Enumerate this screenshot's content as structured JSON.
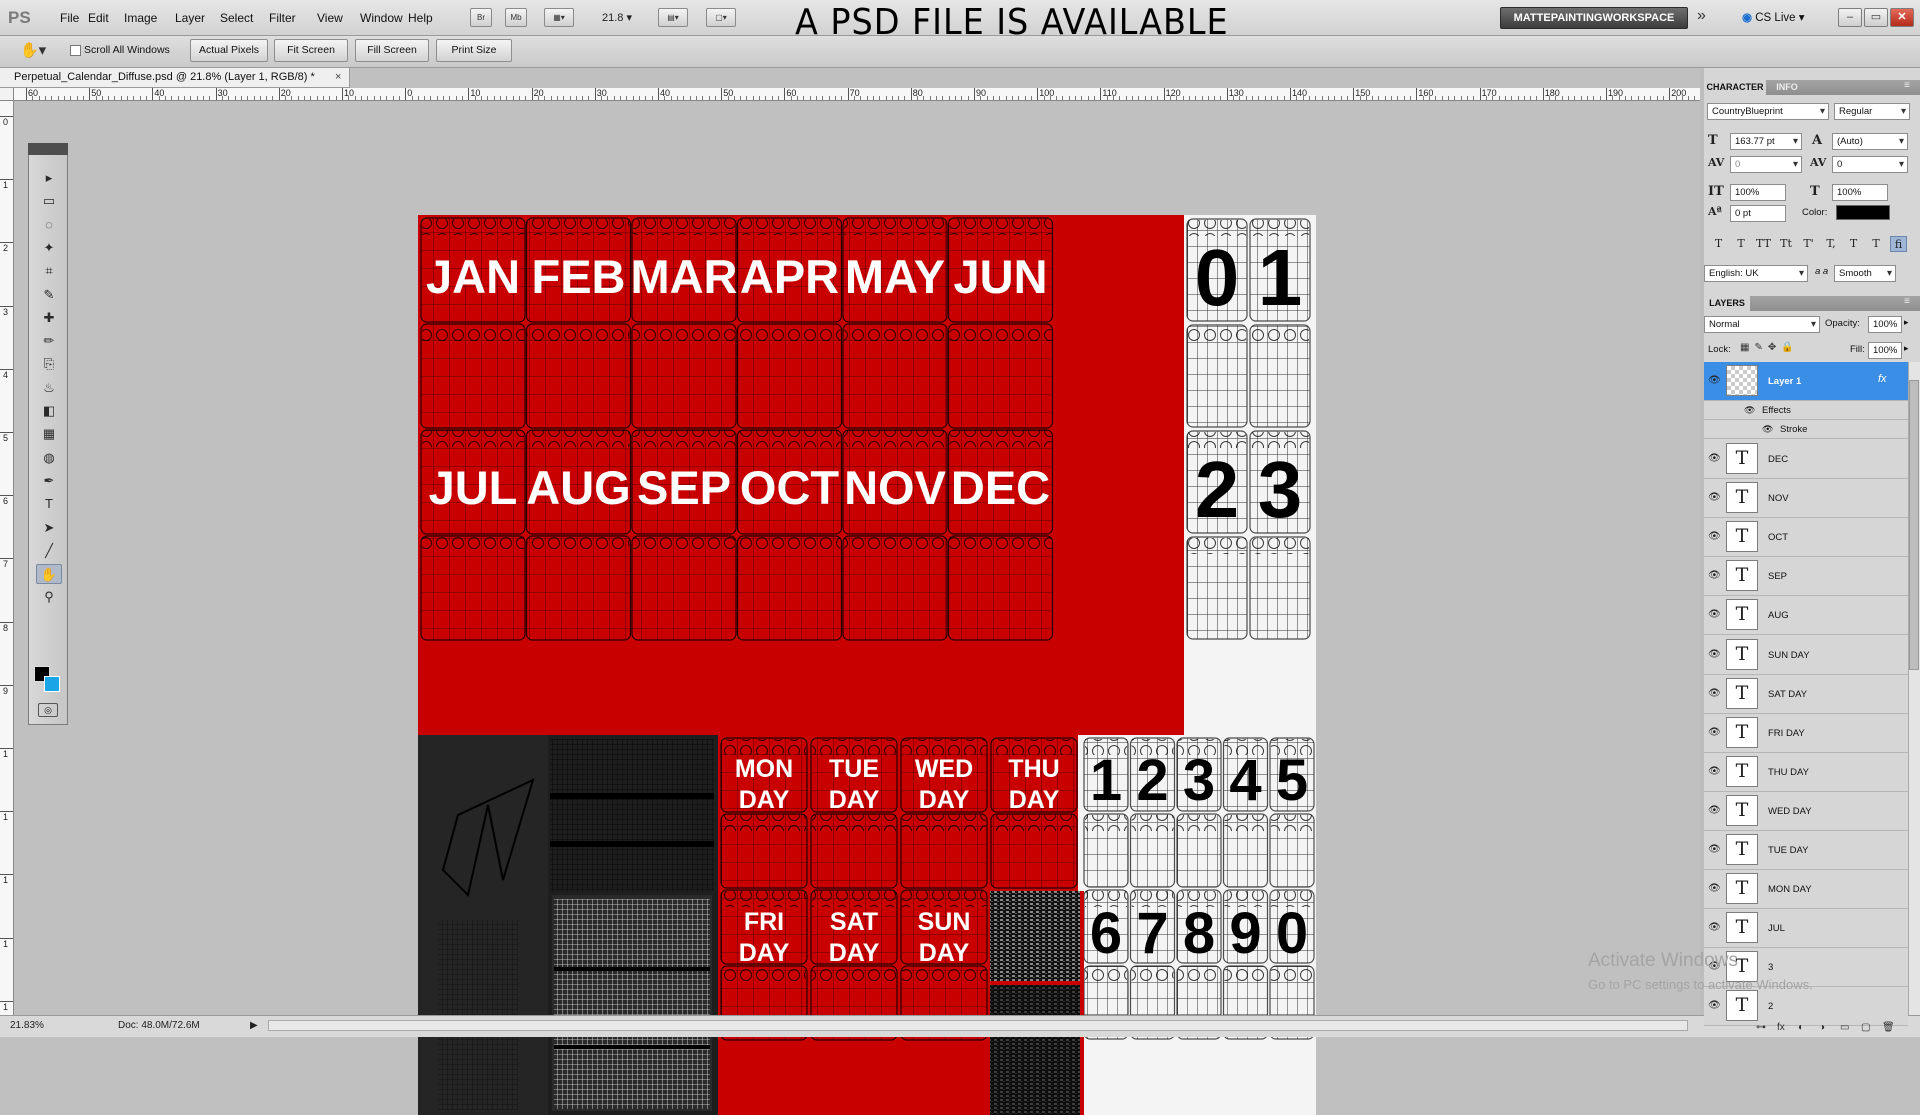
{
  "app": {
    "logo": "PS"
  },
  "menu": [
    "File",
    "Edit",
    "Image",
    "Layer",
    "Select",
    "Filter",
    "View",
    "Window",
    "Help"
  ],
  "toolbar": {
    "zoom": "21.8",
    "icons": [
      "Br",
      "Mb"
    ]
  },
  "headline": "A PSD FILE IS AVAILABLE",
  "workspace": {
    "name": "MATTEPAINTINGWORKSPACE",
    "more": "»",
    "cslive": "CS Live ▾"
  },
  "window_buttons": [
    "–",
    "▭",
    "✕"
  ],
  "options": {
    "scroll_all": "Scroll All Windows",
    "buttons": [
      "Actual Pixels",
      "Fit Screen",
      "Fill Screen",
      "Print Size"
    ]
  },
  "document": {
    "tab_title": "Perpetual_Calendar_Diffuse.psd @ 21.8% (Layer 1, RGB/8) *",
    "close": "×"
  },
  "ruler": {
    "h_labels": [
      "60",
      "50",
      "40",
      "30",
      "20",
      "10",
      "0",
      "10",
      "20",
      "30",
      "40",
      "50",
      "60",
      "70",
      "80",
      "90",
      "100",
      "110",
      "120",
      "130",
      "140",
      "150",
      "160",
      "170",
      "180",
      "190",
      "200"
    ],
    "v_labels": [
      "0",
      "1",
      "2",
      "3",
      "4",
      "5",
      "6",
      "7",
      "8",
      "9",
      "1",
      "1",
      "1",
      "1",
      "1",
      "1"
    ]
  },
  "tools": [
    "▸",
    "▭",
    "◌",
    "✦",
    "⌗",
    "✎",
    "✚",
    "✏",
    "⎘",
    "♨",
    "◧",
    "▦",
    "◍",
    "✒",
    "T",
    "➤",
    "╱",
    "✋",
    "⚲"
  ],
  "status": {
    "zoom": "21.83%",
    "doc": "Doc: 48.0M/72.6M",
    "arrow": "▶"
  },
  "watermark": {
    "line1": "Activate Windows",
    "line2": "Go to PC settings to activate Windows."
  },
  "character_panel": {
    "tabs": [
      "CHARACTER",
      "INFO"
    ],
    "font_family": "CountryBlueprint",
    "font_style": "Regular",
    "font_size": "163.77 pt",
    "leading": "(Auto)",
    "kerning": "0",
    "tracking": "0",
    "vertical_scale": "100%",
    "horizontal_scale": "100%",
    "baseline_shift": "0 pt",
    "color_label": "Color:",
    "text_style_buttons": [
      "T",
      "T",
      "TT",
      "Tt",
      "T'",
      "T,",
      "T",
      "T",
      "fi"
    ],
    "language": "English: UK",
    "aa_label": "a a",
    "antialias": "Smooth"
  },
  "layers_panel": {
    "title": "LAYERS",
    "blend_mode": "Normal",
    "opacity_label": "Opacity:",
    "opacity": "100%",
    "lock_label": "Lock:",
    "fill_label": "Fill:",
    "fill": "100%",
    "active_layer": "Layer 1",
    "fx": "fx",
    "effects_label": "Effects",
    "stroke_label": "Stroke",
    "layers": [
      "DEC",
      "NOV",
      "OCT",
      "SEP",
      "AUG",
      "SUN DAY",
      "SAT DAY",
      "FRI DAY",
      "THU DAY",
      "WED DAY",
      "TUE DAY",
      "MON DAY",
      "JUL",
      "3",
      "2"
    ],
    "footer_icons": [
      "link-icon",
      "fx-icon",
      "mask-icon",
      "adjustment-icon",
      "group-icon",
      "new-layer-icon",
      "trash-icon"
    ]
  },
  "calendar": {
    "months_row1": [
      "JAN",
      "FEB",
      "MAR",
      "APR",
      "MAY",
      "JUN"
    ],
    "months_row2": [
      "JUL",
      "AUG",
      "SEP",
      "OCT",
      "NOV",
      "DEC"
    ],
    "days_row1": [
      [
        "MON",
        "DAY"
      ],
      [
        "TUE",
        "DAY"
      ],
      [
        "WED",
        "DAY"
      ],
      [
        "THU",
        "DAY"
      ]
    ],
    "days_row2": [
      [
        "FRI",
        "DAY"
      ],
      [
        "SAT",
        "DAY"
      ],
      [
        "SUN",
        "DAY"
      ]
    ],
    "top_digits": [
      "0",
      "1"
    ],
    "mid_digits": [
      "2",
      "3"
    ],
    "digits_row1": [
      "1",
      "2",
      "3",
      "4",
      "5"
    ],
    "digits_row2": [
      "6",
      "7",
      "8",
      "9",
      "0"
    ],
    "colors": {
      "red": "#c90000",
      "dark": "#242424",
      "white": "#f4f4f4"
    }
  }
}
